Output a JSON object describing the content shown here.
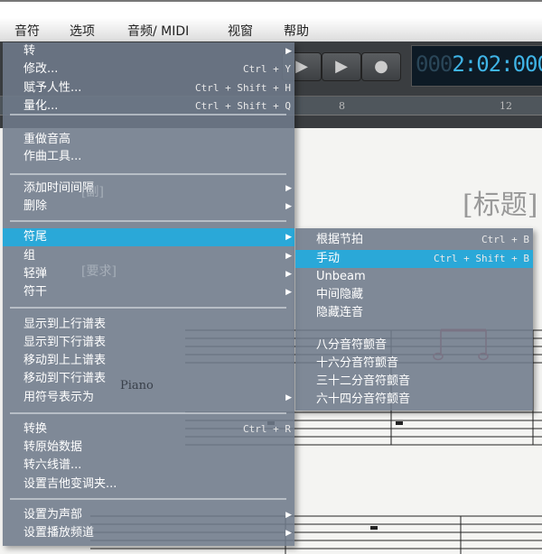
{
  "menubar": [
    "音符",
    "选项",
    "音频/ MIDI",
    "视窗",
    "帮助"
  ],
  "ruler": [
    "8",
    "12"
  ],
  "timecode": {
    "dim": "000",
    "value": "2:02:000"
  },
  "score": {
    "title": "[标题]",
    "subtitle": "[副]",
    "composer": "[要求]",
    "instrument": "Piano"
  },
  "menu": [
    {
      "label": "转",
      "arrow": true
    },
    {
      "label": "修改...",
      "shortcut": "Ctrl + Y"
    },
    {
      "label": "赋予人性...",
      "shortcut": "Ctrl + Shift + H"
    },
    {
      "label": "量化...",
      "shortcut": "Ctrl + Shift + Q"
    },
    {
      "label": "重做音高"
    },
    {
      "label": "作曲工具..."
    },
    {
      "label": "添加时间间隔",
      "arrow": true
    },
    {
      "label": "删除",
      "arrow": true
    },
    {
      "label": "符尾",
      "arrow": true,
      "highlighted": true
    },
    {
      "label": "组",
      "arrow": true
    },
    {
      "label": "轻弹",
      "arrow": true
    },
    {
      "label": "符干",
      "arrow": true
    },
    {
      "label": "显示到上行谱表"
    },
    {
      "label": "显示到下行谱表"
    },
    {
      "label": "移动到上上谱表"
    },
    {
      "label": "移动到下行谱表"
    },
    {
      "label": "用符号表示为",
      "arrow": true
    },
    {
      "label": "转换",
      "shortcut": "Ctrl + R"
    },
    {
      "label": "转原始数据"
    },
    {
      "label": "转六线谱..."
    },
    {
      "label": "设置吉他变调夹..."
    },
    {
      "label": "设置为声部",
      "arrow": true
    },
    {
      "label": "设置播放频道",
      "arrow": true
    }
  ],
  "submenu": [
    {
      "label": "根据节拍",
      "shortcut": "Ctrl + B"
    },
    {
      "label": "手动",
      "shortcut": "Ctrl + Shift + B",
      "highlighted": true
    },
    {
      "label": "Unbeam"
    },
    {
      "label": "中间隐藏"
    },
    {
      "label": "隐藏连音"
    },
    {
      "label": "八分音符颤音"
    },
    {
      "label": "十六分音符颤音"
    },
    {
      "label": "三十二分音符颤音"
    },
    {
      "label": "六十四分音符颤音"
    }
  ],
  "colors": {
    "highlight": "#2aa8d8",
    "menu_bg": "#6e7a8a",
    "timecode": "#3fb4e6",
    "selected_notes": "#c0405a"
  }
}
